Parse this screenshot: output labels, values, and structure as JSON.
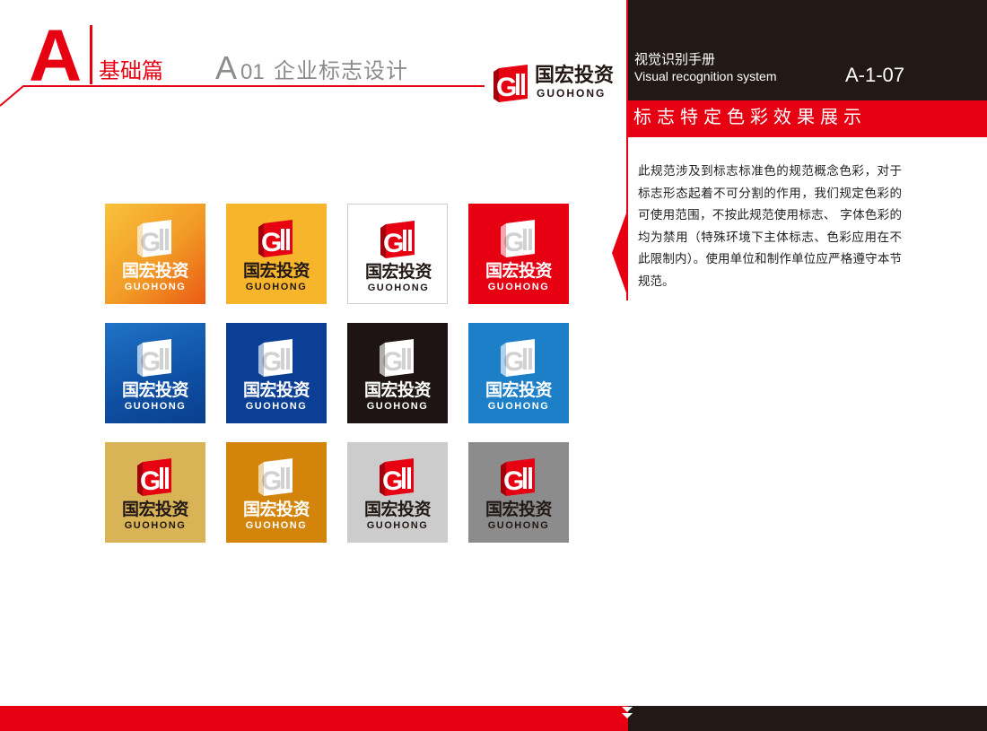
{
  "header": {
    "section_letter": "A",
    "section_label": "基础篇",
    "page_code_letter": "A",
    "page_code_num": "01",
    "page_title": "企业标志设计"
  },
  "logo": {
    "name_cn": "国宏投资",
    "name_en": "GUOHONG"
  },
  "right_panel": {
    "manual_cn": "视觉识别手册",
    "manual_en": "Visual recognition system",
    "page_id": "A-1-07",
    "section_sub": "标志特定色彩效果展示",
    "description": "此规范涉及到标志标准色的规范概念色彩，对于标志形态起着不可分割的作用，我们规定色彩的可使用范围，不按此规范使用标志、 字体色彩的均为禁用（特殊环境下主体标志、色彩应用在不此限制内）。使用单位和制作单位应严格遵守本节规范。"
  },
  "colors": {
    "brand_red": "#e60012",
    "dark": "#221815",
    "grey_text": "#8c8c8c"
  },
  "swatches": [
    {
      "bg": "gradient-orange",
      "mark_color": "white",
      "text_color": "white"
    },
    {
      "bg": "#f7b52c",
      "mark_color": "red",
      "text_color": "dark"
    },
    {
      "bg": "#ffffff",
      "mark_color": "red",
      "text_color": "dark"
    },
    {
      "bg": "#e60012",
      "mark_color": "white",
      "text_color": "white"
    },
    {
      "bg": "gradient-blue",
      "mark_color": "white",
      "text_color": "white"
    },
    {
      "bg": "#0b3f95",
      "mark_color": "white",
      "text_color": "white"
    },
    {
      "bg": "#1e1414",
      "mark_color": "white",
      "text_color": "white"
    },
    {
      "bg": "#1c7fc8",
      "mark_color": "white",
      "text_color": "white"
    },
    {
      "bg": "#d9b456",
      "mark_color": "red",
      "text_color": "dark"
    },
    {
      "bg": "#d3840a",
      "mark_color": "white",
      "text_color": "white"
    },
    {
      "bg": "#cccccc",
      "mark_color": "red",
      "text_color": "dark"
    },
    {
      "bg": "#8c8c8c",
      "mark_color": "red",
      "text_color": "dark"
    }
  ]
}
